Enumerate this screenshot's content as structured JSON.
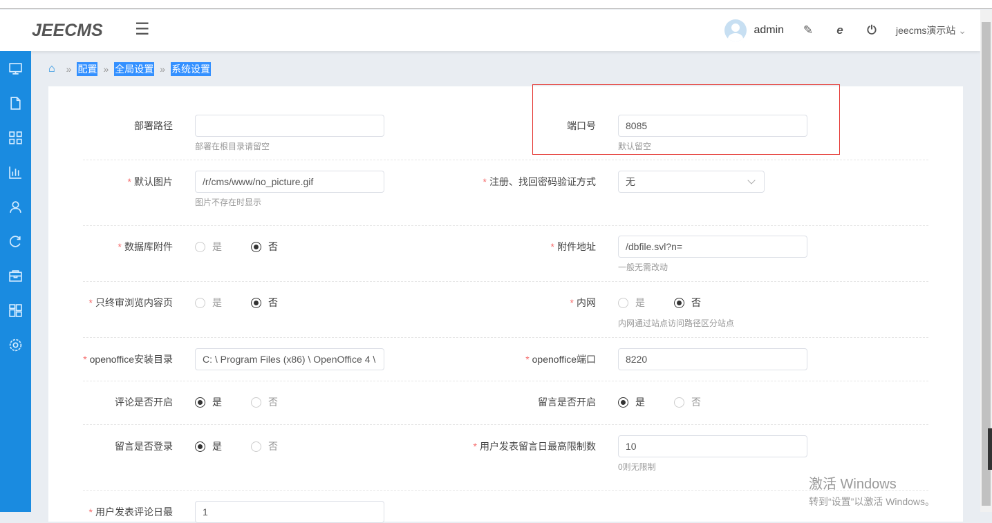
{
  "header": {
    "logo": "JEECMS",
    "user": "admin",
    "site": "jeecms演示站"
  },
  "sidebar": [
    "monitor-icon",
    "document-icon",
    "grid-icon",
    "chart-icon",
    "user-icon",
    "refresh-icon",
    "box-icon",
    "dashboard-icon",
    "gear-icon"
  ],
  "breadcrumb": [
    "配置",
    "全局设置",
    "系统设置"
  ],
  "form": {
    "deploy_path": {
      "label": "部署路径",
      "value": "",
      "hint": "部署在根目录请留空"
    },
    "port": {
      "label": "端口号",
      "value": "8085",
      "hint": "默认留空"
    },
    "default_pic": {
      "label": "默认图片",
      "value": "/r/cms/www/no_picture.gif",
      "hint": "图片不存在时显示"
    },
    "verify": {
      "label": "注册、找回密码验证方式",
      "value": "无"
    },
    "db_attach": {
      "label": "数据库附件",
      "options": [
        "是",
        "否"
      ],
      "selected": "否"
    },
    "attach_url": {
      "label": "附件地址",
      "value": "/dbfile.svl?n=",
      "hint": "一般无需改动"
    },
    "final_review": {
      "label": "只终审浏览内容页",
      "options": [
        "是",
        "否"
      ],
      "selected": "否"
    },
    "intranet": {
      "label": "内网",
      "options": [
        "是",
        "否"
      ],
      "selected": "否",
      "hint": "内网通过站点访问路径区分站点"
    },
    "oo_dir": {
      "label": "openoffice安装目录",
      "value": "C: \\ Program Files (x86) \\ OpenOffice 4 \\"
    },
    "oo_port": {
      "label": "openoffice端口",
      "value": "8220"
    },
    "comment_on": {
      "label": "评论是否开启",
      "options": [
        "是",
        "否"
      ],
      "selected": "是"
    },
    "guestbook_on": {
      "label": "留言是否开启",
      "options": [
        "是",
        "否"
      ],
      "selected": "是"
    },
    "guestbook_login": {
      "label": "留言是否登录",
      "options": [
        "是",
        "否"
      ],
      "selected": "是"
    },
    "guestbook_limit": {
      "label": "用户发表留言日最高限制数",
      "value": "10",
      "hint": "0则无限制"
    },
    "comment_limit": {
      "label": "用户发表评论日最",
      "value": "1"
    }
  },
  "watermark": {
    "title": "激活 Windows",
    "sub": "转到“设置”以激活 Windows。"
  }
}
